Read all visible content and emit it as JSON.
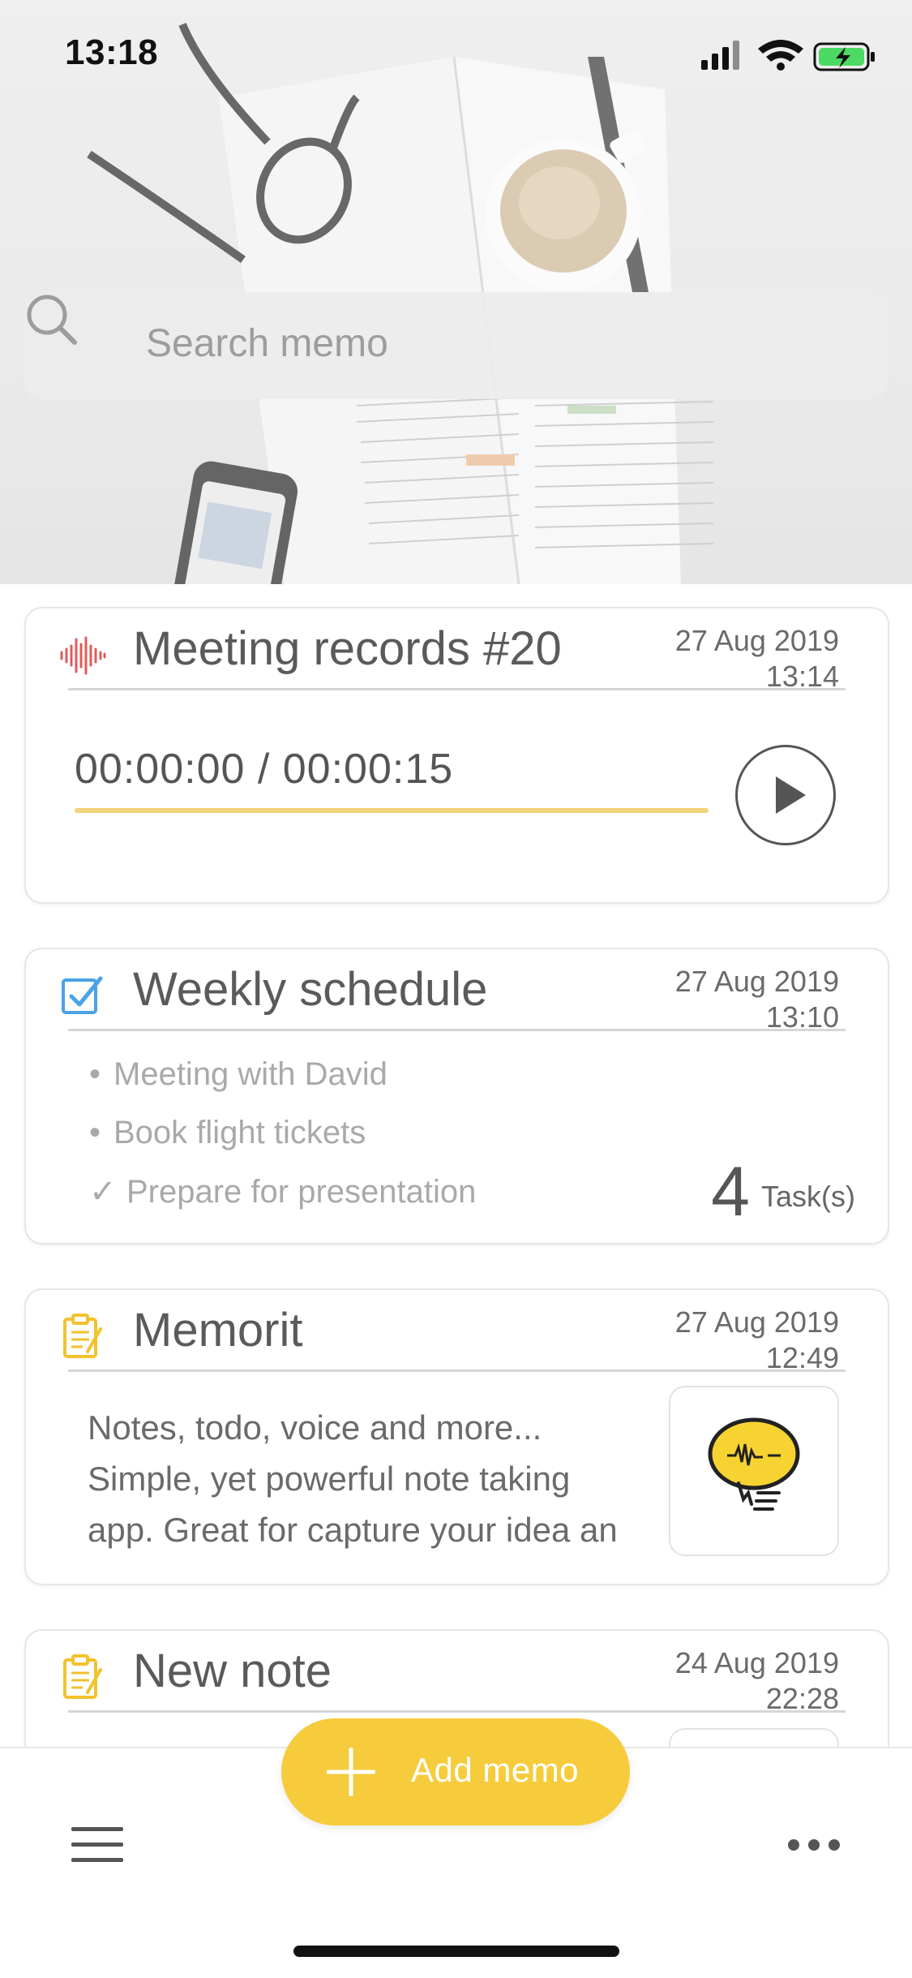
{
  "status_bar": {
    "time": "13:18"
  },
  "search": {
    "placeholder": "Search memo"
  },
  "memos": [
    {
      "type": "voice",
      "title": "Meeting records #20",
      "date": "27 Aug 2019",
      "time": "13:14",
      "audio_progress_text": "00:00:00 / 00:00:15",
      "icon": "waveform-icon",
      "icon_color": "#e05b5b"
    },
    {
      "type": "todo",
      "title": "Weekly schedule",
      "date": "27 Aug 2019",
      "time": "13:10",
      "icon": "checkbox-icon",
      "icon_color": "#4aa3e8",
      "tasks": [
        {
          "bullet": "•",
          "text": "Meeting with David",
          "done": false
        },
        {
          "bullet": "•",
          "text": "Book flight tickets",
          "done": false
        },
        {
          "bullet": "✓",
          "text": "Prepare for presentation",
          "done": true
        }
      ],
      "task_count": "4",
      "task_label": "Task(s)"
    },
    {
      "type": "note",
      "title": "Memorit",
      "date": "27 Aug 2019",
      "time": "12:49",
      "icon": "note-icon",
      "icon_color": "#f2c22d",
      "body_lines": [
        "Notes, todo, voice and more...",
        "Simple, yet powerful note taking",
        "app. Great for capture your idea an"
      ],
      "thumbnail": "memorit-logo-icon"
    },
    {
      "type": "note",
      "title": "New note",
      "date": "24 Aug 2019",
      "time": "22:28",
      "icon": "note-icon",
      "icon_color": "#f2c22d"
    }
  ],
  "fab": {
    "label": "Add memo",
    "color": "#f6cc3d"
  },
  "bottom_bar": {
    "left_icon": "hamburger-menu-icon",
    "right_icon": "more-dots-icon"
  }
}
